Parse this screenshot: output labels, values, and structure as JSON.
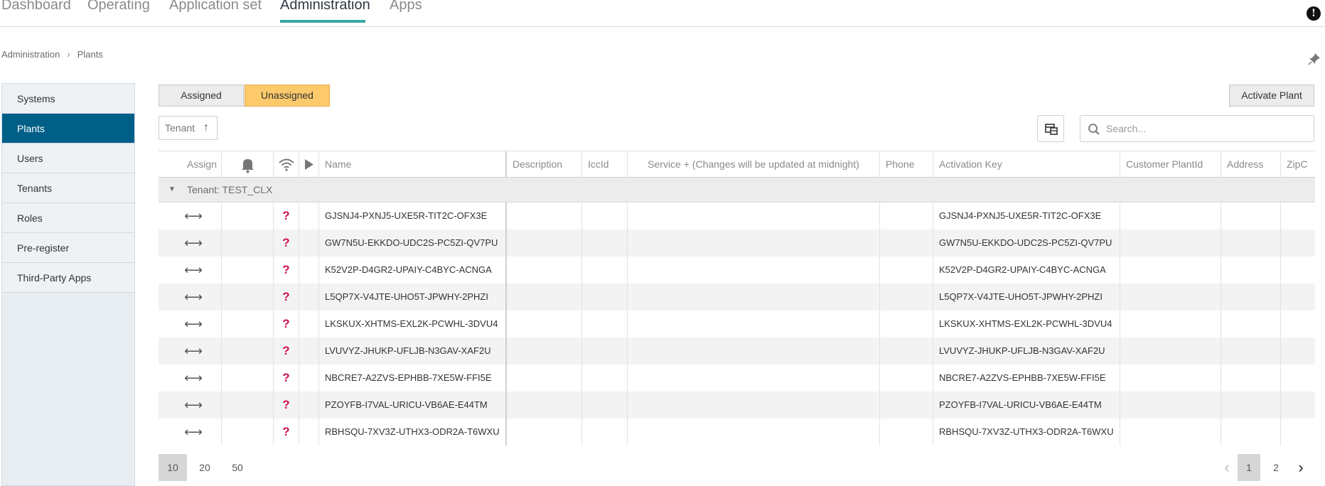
{
  "topnav": {
    "tabs": [
      {
        "label": "Dashboard",
        "active": false
      },
      {
        "label": "Operating",
        "active": false
      },
      {
        "label": "Application set",
        "active": false
      },
      {
        "label": "Administration",
        "active": true
      },
      {
        "label": "Apps",
        "active": false
      }
    ],
    "accent_color": "#39a6a3"
  },
  "breadcrumb": {
    "root": "Administration",
    "current": "Plants"
  },
  "sidebar": {
    "items": [
      {
        "label": "Systems",
        "active": false
      },
      {
        "label": "Plants",
        "active": true
      },
      {
        "label": "Users",
        "active": false
      },
      {
        "label": "Tenants",
        "active": false
      },
      {
        "label": "Roles",
        "active": false
      },
      {
        "label": "Pre-register",
        "active": false
      },
      {
        "label": "Third-Party Apps",
        "active": false
      }
    ],
    "active_color": "#005f87"
  },
  "toolbar": {
    "assigned_label": "Assigned",
    "unassigned_label": "Unassigned",
    "selected_filter": "Unassigned",
    "activate_label": "Activate Plant",
    "tenant_sort_label": "Tenant",
    "search_placeholder": "Search..."
  },
  "table": {
    "columns": {
      "assign": "Assign",
      "name": "Name",
      "description": "Description",
      "iccid": "IccId",
      "service": "Service + (Changes will be updated at midnight)",
      "phone": "Phone",
      "activation_key": "Activation Key",
      "customer_plant_id": "Customer PlantId",
      "address": "Address",
      "zip": "ZipC"
    },
    "group_label": "Tenant: TEST_CLX",
    "rows": [
      {
        "name": "GJSNJ4-PXNJ5-UXE5R-TIT2C-OFX3E",
        "activation_key": "GJSNJ4-PXNJ5-UXE5R-TIT2C-OFX3E"
      },
      {
        "name": "GW7N5U-EKKDO-UDC2S-PC5ZI-QV7PU",
        "activation_key": "GW7N5U-EKKDO-UDC2S-PC5ZI-QV7PU"
      },
      {
        "name": "K52V2P-D4GR2-UPAIY-C4BYC-ACNGA",
        "activation_key": "K52V2P-D4GR2-UPAIY-C4BYC-ACNGA"
      },
      {
        "name": "L5QP7X-V4JTE-UHO5T-JPWHY-2PHZI",
        "activation_key": "L5QP7X-V4JTE-UHO5T-JPWHY-2PHZI"
      },
      {
        "name": "LKSKUX-XHTMS-EXL2K-PCWHL-3DVU4",
        "activation_key": "LKSKUX-XHTMS-EXL2K-PCWHL-3DVU4"
      },
      {
        "name": "LVUVYZ-JHUKP-UFLJB-N3GAV-XAF2U",
        "activation_key": "LVUVYZ-JHUKP-UFLJB-N3GAV-XAF2U"
      },
      {
        "name": "NBCRE7-A2ZVS-EPHBB-7XE5W-FFI5E",
        "activation_key": "NBCRE7-A2ZVS-EPHBB-7XE5W-FFI5E"
      },
      {
        "name": "PZOYFB-I7VAL-URICU-VB6AE-E44TM",
        "activation_key": "PZOYFB-I7VAL-URICU-VB6AE-E44TM"
      },
      {
        "name": "RBHSQU-7XV3Z-UTHX3-ODR2A-T6WXU",
        "activation_key": "RBHSQU-7XV3Z-UTHX3-ODR2A-T6WXU"
      }
    ],
    "status_icon": "question-icon",
    "status_color": "#d0104f"
  },
  "footer": {
    "page_sizes": [
      "10",
      "20",
      "50"
    ],
    "selected_page_size": "10",
    "pages": [
      "1",
      "2"
    ],
    "current_page": "1"
  }
}
